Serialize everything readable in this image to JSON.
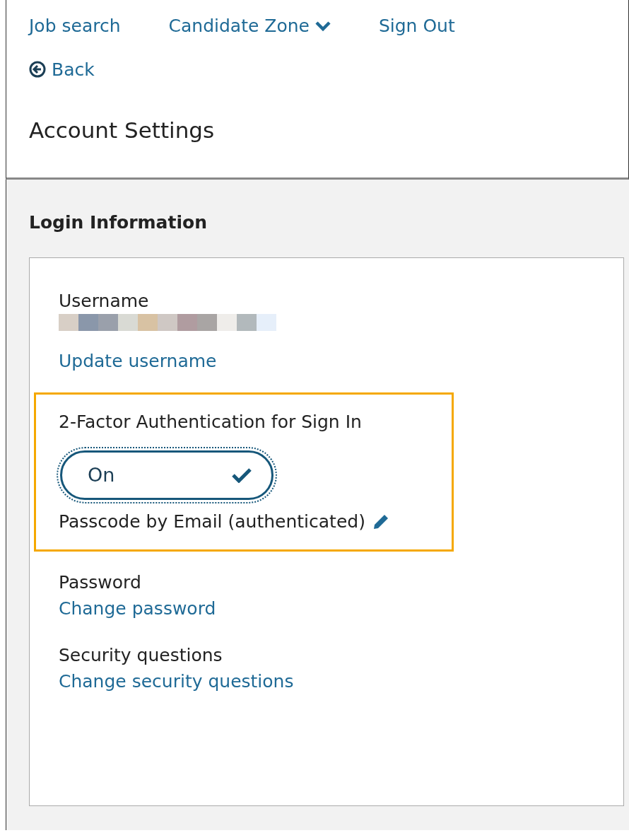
{
  "nav": [
    {
      "label": "Job search",
      "dropdown": false
    },
    {
      "label": "Candidate Zone",
      "dropdown": true
    },
    {
      "label": "Sign Out",
      "dropdown": false
    }
  ],
  "back": {
    "label": "Back"
  },
  "page_title": "Account Settings",
  "section_title": "Login Information",
  "username": {
    "label": "Username",
    "link": "Update username"
  },
  "two_factor": {
    "label": "2-Factor Authentication for Sign In",
    "highlighted": true,
    "toggle": {
      "label": "On",
      "on": true
    },
    "method": "Passcode by Email (authenticated)"
  },
  "password": {
    "label": "Password",
    "link": "Change password"
  },
  "security": {
    "label": "Security questions",
    "link": "Change security questions"
  }
}
